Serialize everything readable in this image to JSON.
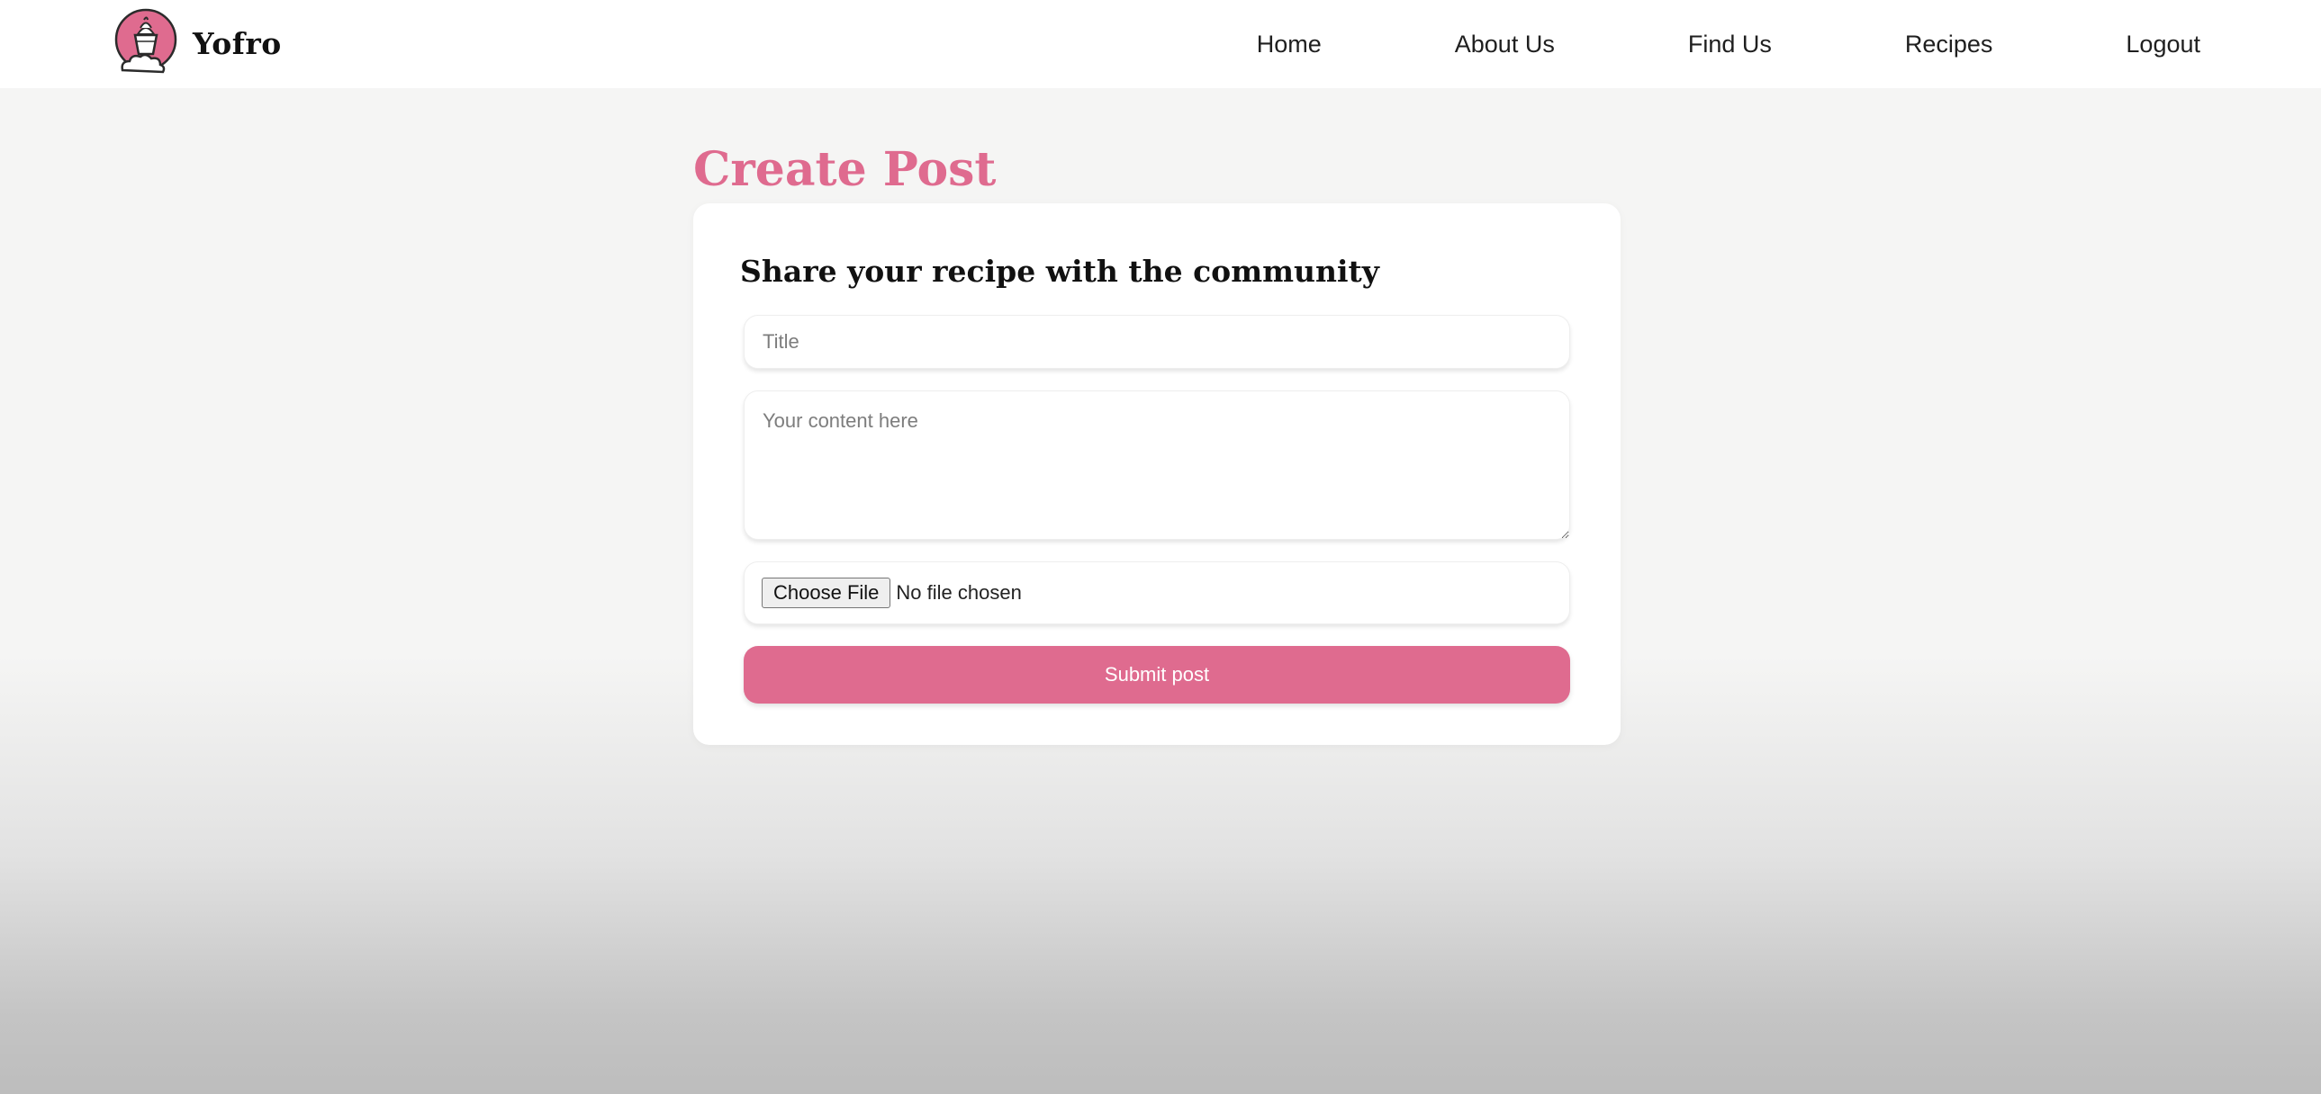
{
  "brand": {
    "name": "Yofro",
    "logo_icon": "frozen-yogurt-cup-icon",
    "accent_color": "#df6b8f"
  },
  "nav": {
    "items": [
      {
        "label": "Home"
      },
      {
        "label": "About Us"
      },
      {
        "label": "Find Us"
      },
      {
        "label": "Recipes"
      },
      {
        "label": "Logout"
      }
    ]
  },
  "page": {
    "title": "Create Post"
  },
  "form": {
    "heading": "Share your recipe with the community",
    "title_placeholder": "Title",
    "title_value": "",
    "content_placeholder": "Your content here",
    "content_value": "",
    "file_button_label": "Choose File",
    "file_status": "No file chosen",
    "submit_label": "Submit post"
  },
  "colors": {
    "accent": "#df6b8f",
    "page_background": "#f5f5f4",
    "card_background": "#ffffff"
  }
}
